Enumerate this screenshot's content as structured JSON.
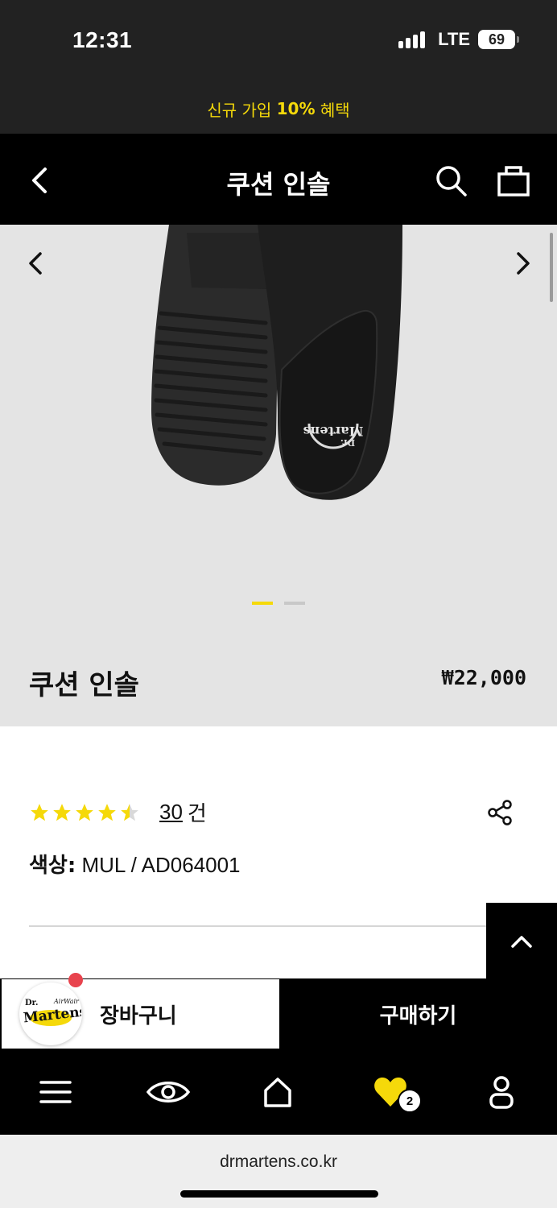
{
  "status_bar": {
    "time": "12:31",
    "network": "LTE",
    "battery": "69"
  },
  "promo": {
    "prefix": "신규 가입 ",
    "highlight": "10%",
    "suffix": " 혜택"
  },
  "header": {
    "title": "쿠션 인솔",
    "back_icon": "chevron-left-icon",
    "search_icon": "search-icon",
    "bag_icon": "shopping-bag-icon"
  },
  "gallery": {
    "current_slide": 1,
    "total_slides": 2
  },
  "product": {
    "name": "쿠션 인솔",
    "price": "₩22,000",
    "rating": 4.5,
    "review_count": "30",
    "review_unit": "건",
    "color_label": "색상:",
    "color_value": " MUL / AD064001"
  },
  "actions": {
    "cart_label": "장바구니",
    "buy_label": "구매하기"
  },
  "tabbar": {
    "items": [
      "menu-icon",
      "eye-icon",
      "home-icon",
      "heart-icon",
      "user-icon"
    ],
    "favorites_count": "2"
  },
  "browser": {
    "url": "drmartens.co.kr"
  },
  "colors": {
    "accent": "#f5d90a",
    "dark": "#000000",
    "badge": "#e8434d"
  }
}
